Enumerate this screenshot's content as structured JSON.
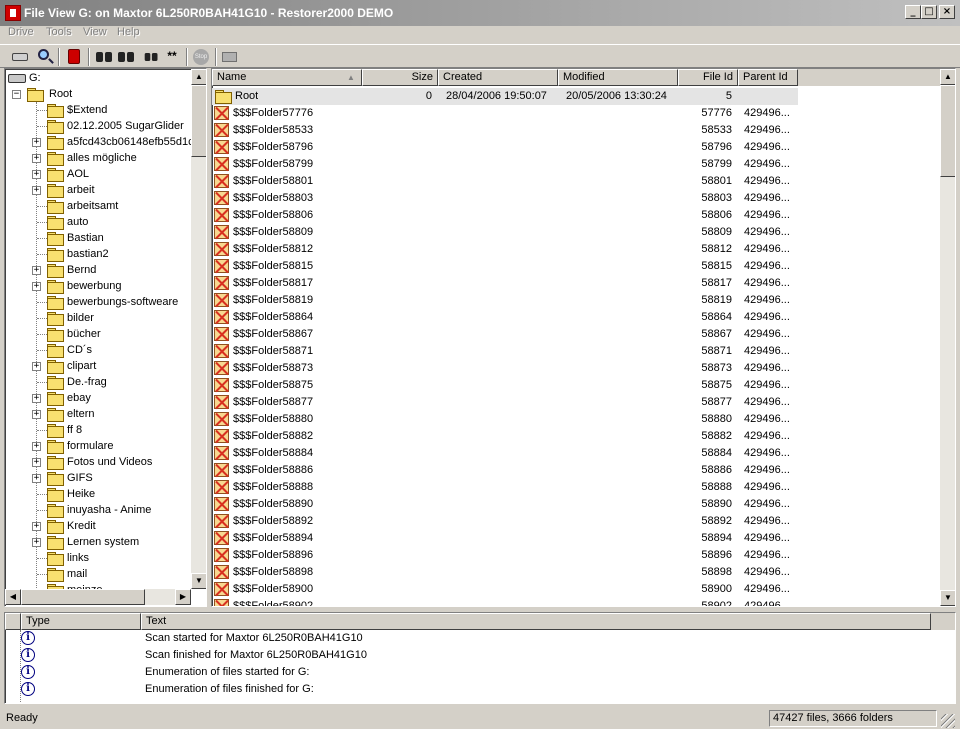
{
  "window": {
    "title": "File View G: on Maxtor 6L250R0BAH41G10 - Restorer2000 DEMO",
    "minimize": "_",
    "maximize": "□",
    "close": "×"
  },
  "menu": [
    "Drive",
    "Tools",
    "View",
    "Help"
  ],
  "toolbar": {
    "stop_label": "Stop",
    "find_next_label": "**"
  },
  "tree": {
    "drive": "G:",
    "root": "Root",
    "items": [
      {
        "label": "$Extend",
        "expandable": false
      },
      {
        "label": "02.12.2005 SugarGlider",
        "expandable": false
      },
      {
        "label": "a5fcd43cb06148efb55d1c",
        "expandable": true
      },
      {
        "label": "alles mögliche",
        "expandable": true
      },
      {
        "label": "AOL",
        "expandable": true
      },
      {
        "label": "arbeit",
        "expandable": true
      },
      {
        "label": "arbeitsamt",
        "expandable": false
      },
      {
        "label": "auto",
        "expandable": false
      },
      {
        "label": "Bastian",
        "expandable": false
      },
      {
        "label": "bastian2",
        "expandable": false
      },
      {
        "label": "Bernd",
        "expandable": true
      },
      {
        "label": "bewerbung",
        "expandable": true
      },
      {
        "label": "bewerbungs-softweare",
        "expandable": false
      },
      {
        "label": "bilder",
        "expandable": false
      },
      {
        "label": "bücher",
        "expandable": false
      },
      {
        "label": "CD´s",
        "expandable": false
      },
      {
        "label": "clipart",
        "expandable": true
      },
      {
        "label": "De.-frag",
        "expandable": false
      },
      {
        "label": "ebay",
        "expandable": true
      },
      {
        "label": "eltern",
        "expandable": true
      },
      {
        "label": "ff 8",
        "expandable": false
      },
      {
        "label": "formulare",
        "expandable": true
      },
      {
        "label": "Fotos und Videos",
        "expandable": true
      },
      {
        "label": "GIFS",
        "expandable": true
      },
      {
        "label": "Heike",
        "expandable": false
      },
      {
        "label": "inuyasha - Anime",
        "expandable": false
      },
      {
        "label": "Kredit",
        "expandable": true
      },
      {
        "label": "Lernen system",
        "expandable": true
      },
      {
        "label": "links",
        "expandable": false
      },
      {
        "label": "mail",
        "expandable": false
      },
      {
        "label": "meinze",
        "expandable": false
      }
    ]
  },
  "list": {
    "columns": [
      "Name",
      "Size",
      "Created",
      "Modified",
      "File Id",
      "Parent Id"
    ],
    "root_row": {
      "name": "Root",
      "size": "0",
      "created": "28/04/2006 19:50:07",
      "modified": "20/05/2006 13:30:24",
      "file_id": "5",
      "parent_id": ""
    },
    "rows": [
      {
        "name": "$$$Folder57776",
        "file_id": "57776",
        "parent_id": "429496..."
      },
      {
        "name": "$$$Folder58533",
        "file_id": "58533",
        "parent_id": "429496..."
      },
      {
        "name": "$$$Folder58796",
        "file_id": "58796",
        "parent_id": "429496..."
      },
      {
        "name": "$$$Folder58799",
        "file_id": "58799",
        "parent_id": "429496..."
      },
      {
        "name": "$$$Folder58801",
        "file_id": "58801",
        "parent_id": "429496..."
      },
      {
        "name": "$$$Folder58803",
        "file_id": "58803",
        "parent_id": "429496..."
      },
      {
        "name": "$$$Folder58806",
        "file_id": "58806",
        "parent_id": "429496..."
      },
      {
        "name": "$$$Folder58809",
        "file_id": "58809",
        "parent_id": "429496..."
      },
      {
        "name": "$$$Folder58812",
        "file_id": "58812",
        "parent_id": "429496..."
      },
      {
        "name": "$$$Folder58815",
        "file_id": "58815",
        "parent_id": "429496..."
      },
      {
        "name": "$$$Folder58817",
        "file_id": "58817",
        "parent_id": "429496..."
      },
      {
        "name": "$$$Folder58819",
        "file_id": "58819",
        "parent_id": "429496..."
      },
      {
        "name": "$$$Folder58864",
        "file_id": "58864",
        "parent_id": "429496..."
      },
      {
        "name": "$$$Folder58867",
        "file_id": "58867",
        "parent_id": "429496..."
      },
      {
        "name": "$$$Folder58871",
        "file_id": "58871",
        "parent_id": "429496..."
      },
      {
        "name": "$$$Folder58873",
        "file_id": "58873",
        "parent_id": "429496..."
      },
      {
        "name": "$$$Folder58875",
        "file_id": "58875",
        "parent_id": "429496..."
      },
      {
        "name": "$$$Folder58877",
        "file_id": "58877",
        "parent_id": "429496..."
      },
      {
        "name": "$$$Folder58880",
        "file_id": "58880",
        "parent_id": "429496..."
      },
      {
        "name": "$$$Folder58882",
        "file_id": "58882",
        "parent_id": "429496..."
      },
      {
        "name": "$$$Folder58884",
        "file_id": "58884",
        "parent_id": "429496..."
      },
      {
        "name": "$$$Folder58886",
        "file_id": "58886",
        "parent_id": "429496..."
      },
      {
        "name": "$$$Folder58888",
        "file_id": "58888",
        "parent_id": "429496..."
      },
      {
        "name": "$$$Folder58890",
        "file_id": "58890",
        "parent_id": "429496..."
      },
      {
        "name": "$$$Folder58892",
        "file_id": "58892",
        "parent_id": "429496..."
      },
      {
        "name": "$$$Folder58894",
        "file_id": "58894",
        "parent_id": "429496..."
      },
      {
        "name": "$$$Folder58896",
        "file_id": "58896",
        "parent_id": "429496..."
      },
      {
        "name": "$$$Folder58898",
        "file_id": "58898",
        "parent_id": "429496..."
      },
      {
        "name": "$$$Folder58900",
        "file_id": "58900",
        "parent_id": "429496..."
      },
      {
        "name": "$$$Folder58902",
        "file_id": "58902",
        "parent_id": "429496..."
      }
    ]
  },
  "log": {
    "columns": [
      "Type",
      "Text"
    ],
    "rows": [
      {
        "icon": "info-icon",
        "text": "Scan started for Maxtor 6L250R0BAH41G10"
      },
      {
        "icon": "info-icon",
        "text": "Scan finished for Maxtor 6L250R0BAH41G10"
      },
      {
        "icon": "info-icon",
        "text": "Enumeration of files started for G:"
      },
      {
        "icon": "info-icon",
        "text": "Enumeration of files finished for G:"
      }
    ]
  },
  "status": {
    "text": "Ready",
    "summary": "47427 files, 3666 folders"
  }
}
